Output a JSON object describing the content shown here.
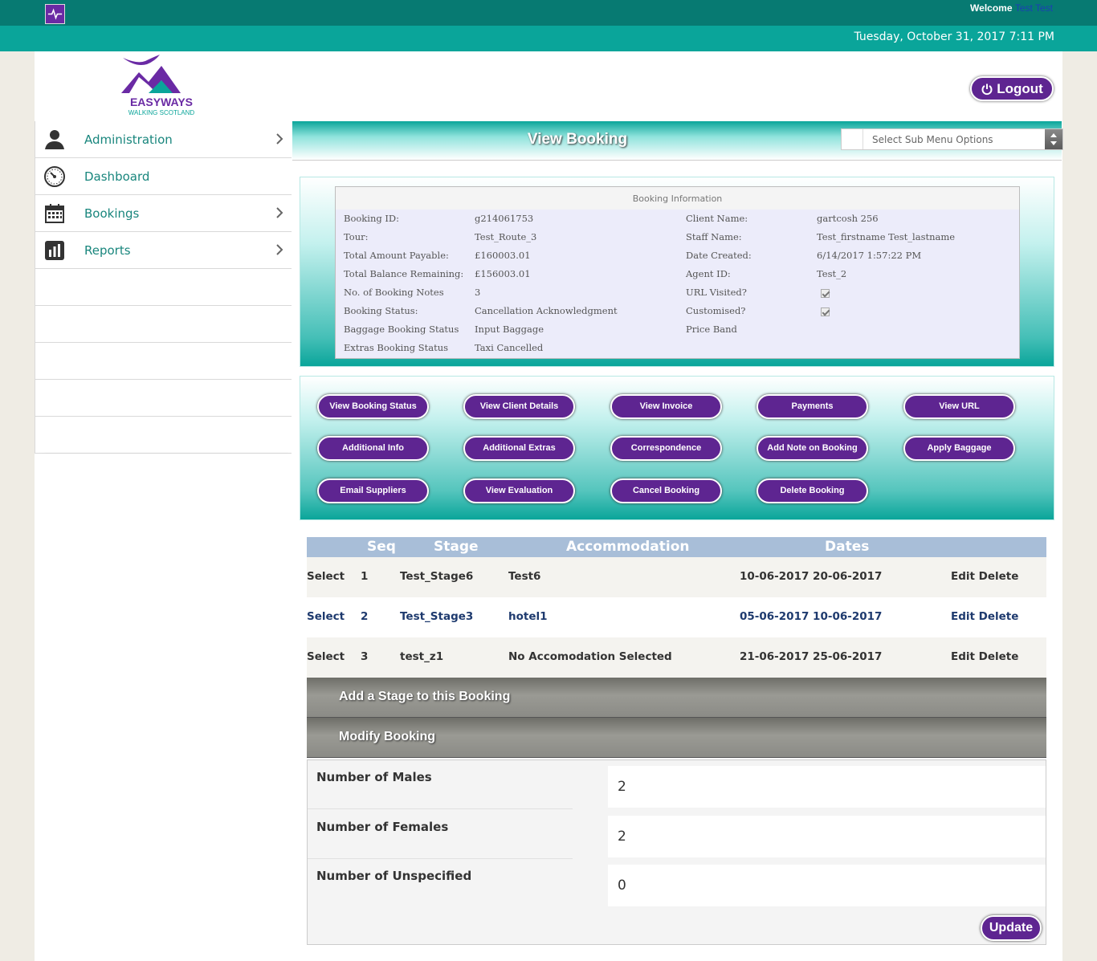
{
  "header": {
    "welcome_label": "Welcome",
    "welcome_user": "Test Test",
    "datetime": "Tuesday, October 31, 2017 7:11 PM",
    "logout_label": "Logout",
    "logo_text": "EASYWAYS",
    "logo_subtext": "WALKING SCOTLAND"
  },
  "sidebar": {
    "items": [
      {
        "label": "Administration",
        "icon": "user-icon"
      },
      {
        "label": "Dashboard",
        "icon": "dashboard-icon"
      },
      {
        "label": "Bookings",
        "icon": "calendar-icon"
      },
      {
        "label": "Reports",
        "icon": "chart-icon"
      }
    ]
  },
  "page": {
    "title": "View Booking",
    "submenu_placeholder": "Select Sub Menu Options"
  },
  "booking_info": {
    "title": "Booking Information",
    "left": [
      {
        "label": "Booking ID:",
        "value": "g214061753"
      },
      {
        "label": "Tour:",
        "value": "Test_Route_3"
      },
      {
        "label": "Total Amount Payable:",
        "value": "£160003.01"
      },
      {
        "label": "Total Balance Remaining:",
        "value": "£156003.01"
      },
      {
        "label": "No. of Booking Notes",
        "value": "3"
      },
      {
        "label": "Booking Status:",
        "value": "Cancellation Acknowledgment"
      },
      {
        "label": "Baggage Booking Status",
        "value": "Input Baggage"
      },
      {
        "label": "Extras Booking Status",
        "value": "Taxi Cancelled"
      }
    ],
    "right": [
      {
        "label": "Client Name:",
        "value": "gartcosh 256"
      },
      {
        "label": "Staff Name:",
        "value": "Test_firstname Test_lastname"
      },
      {
        "label": "Date Created:",
        "value": "6/14/2017 1:57:22 PM"
      },
      {
        "label": "Agent ID:",
        "value": "Test_2"
      },
      {
        "label": "URL Visited?",
        "value": ""
      },
      {
        "label": "Customised?",
        "value": ""
      },
      {
        "label": "Price Band",
        "value": ""
      }
    ],
    "url_visited_checked": true,
    "customised_checked": true
  },
  "actions": [
    "View Booking Status",
    "View Client Details",
    "View Invoice",
    "Payments",
    "View URL",
    "Additional Info",
    "Additional Extras",
    "Correspondence",
    "Add Note on Booking",
    "Apply Baggage",
    "Email Suppliers",
    "View Evaluation",
    "Cancel Booking",
    "Delete Booking"
  ],
  "stages": {
    "headers": {
      "seq": "Seq",
      "stage": "Stage",
      "accommodation": "Accommodation",
      "dates": "Dates"
    },
    "rows": [
      {
        "select": "Select",
        "seq": "1",
        "stage": "Test_Stage6",
        "accommodation": "Test6",
        "dates": "10-06-2017 20-06-2017",
        "actions": "Edit Delete"
      },
      {
        "select": "Select",
        "seq": "2",
        "stage": "Test_Stage3",
        "accommodation": "hotel1",
        "dates": "05-06-2017 10-06-2017",
        "actions": "Edit Delete"
      },
      {
        "select": "Select",
        "seq": "3",
        "stage": "test_z1",
        "accommodation": "No Accomodation Selected",
        "dates": "21-06-2017 25-06-2017",
        "actions": "Edit Delete"
      }
    ],
    "add_stage_label": "Add a Stage to this Booking",
    "modify_label": "Modify Booking"
  },
  "modify": {
    "males_label": "Number of Males",
    "males_value": "2",
    "females_label": "Number of Females",
    "females_value": "2",
    "unspecified_label": "Number of Unspecified",
    "unspecified_value": "0",
    "update_label": "Update"
  }
}
